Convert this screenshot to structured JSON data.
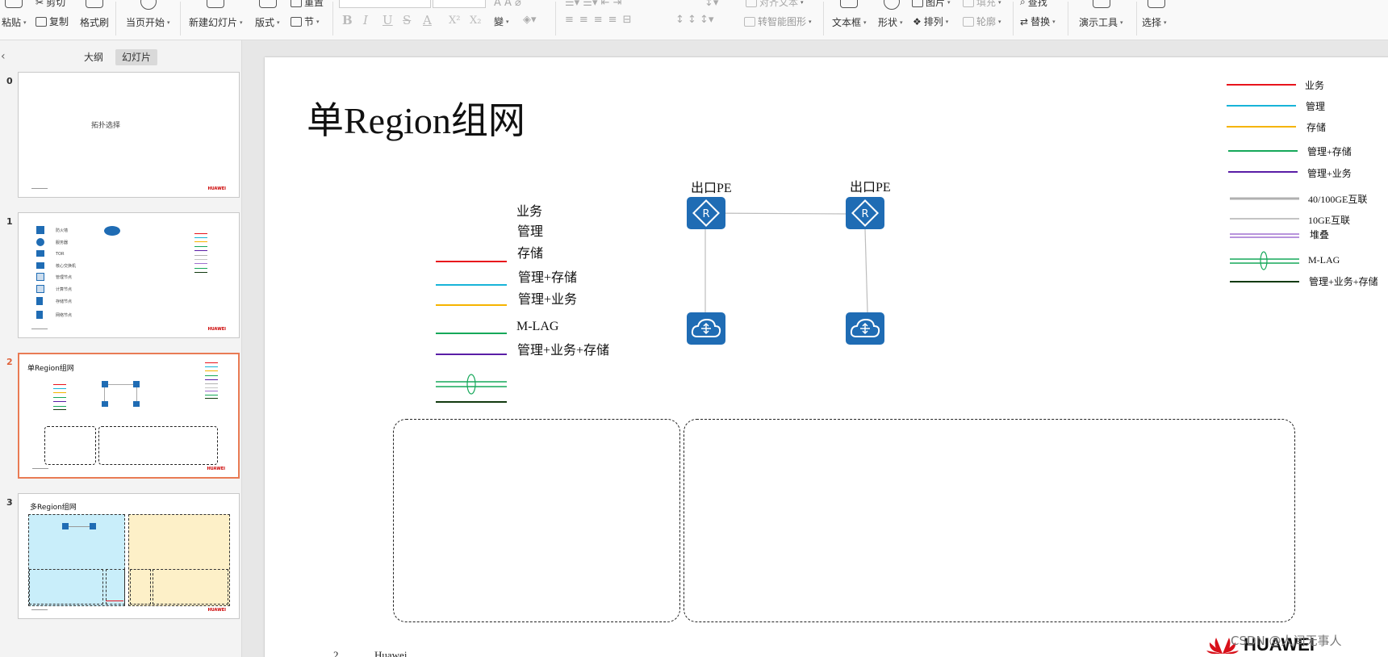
{
  "ribbon": {
    "paste": "粘贴",
    "cut": "剪切",
    "copy": "复制",
    "format_painter": "格式刷",
    "from_current": "当页开始",
    "new_slide": "新建幻灯片",
    "layout": "版式",
    "section": "节",
    "reset": "重置",
    "bold": "B",
    "italic": "I",
    "underline": "U",
    "strike": "S",
    "font_color": "A",
    "superscript": "X²",
    "subscript": "X₂",
    "phonetic": "變",
    "align_text": "对齐文本",
    "smart_shape": "转智能图形",
    "textbox": "文本框",
    "shapes": "形状",
    "arrange": "排列",
    "outline": "轮廓",
    "picture": "图片",
    "fill": "填充",
    "find": "查找",
    "replace": "替换",
    "present_tools": "演示工具",
    "select": "选择"
  },
  "left_panel": {
    "tab_outline": "大纲",
    "tab_slides": "幻灯片",
    "slides": [
      {
        "num": "0",
        "title": "拓扑选择"
      },
      {
        "num": "1",
        "items": [
          "防火墙",
          "服务器",
          "TOR",
          "核心交换机",
          "管理节点",
          "计算节点",
          "存储节点",
          "网络节点"
        ]
      },
      {
        "num": "2",
        "title": "单Region组网"
      },
      {
        "num": "3",
        "title": "多Region组网"
      }
    ],
    "brand": "HUAWEI"
  },
  "slide": {
    "title": "单Region组网",
    "legend_main": [
      {
        "label": "业务",
        "color": "#e8141c"
      },
      {
        "label": "管理",
        "color": "#18b4d8"
      },
      {
        "label": "存储",
        "color": "#f5b400"
      },
      {
        "label": "管理+存储",
        "color": "#16a85a"
      },
      {
        "label": "管理+业务",
        "color": "#5a1ea6"
      },
      {
        "label": "M-LAG",
        "color": "#16a85a"
      },
      {
        "label": "管理+业务+存储",
        "color": "#123a10"
      }
    ],
    "legend_right": [
      {
        "label": "业务",
        "color": "#e8141c"
      },
      {
        "label": "管理",
        "color": "#18b4d8"
      },
      {
        "label": "存储",
        "color": "#f5b400"
      },
      {
        "label": "管理+存储",
        "color": "#16a85a"
      },
      {
        "label": "管理+业务",
        "color": "#5a1ea6"
      },
      {
        "label": "40/100GE互联",
        "color": "#b0b0b0"
      },
      {
        "label": "10GE互联",
        "color": "#c4c4c4"
      },
      {
        "label": "堆叠",
        "color": "#a070d0"
      },
      {
        "label": "M-LAG",
        "color": "#16a85a"
      },
      {
        "label": "管理+业务+存储",
        "color": "#123a10"
      }
    ],
    "pe_label": "出口PE",
    "page_number": "2",
    "footer_text": "Huawei",
    "logo_text": "HUAWEI"
  },
  "watermark": "CSDN @人间无事人"
}
